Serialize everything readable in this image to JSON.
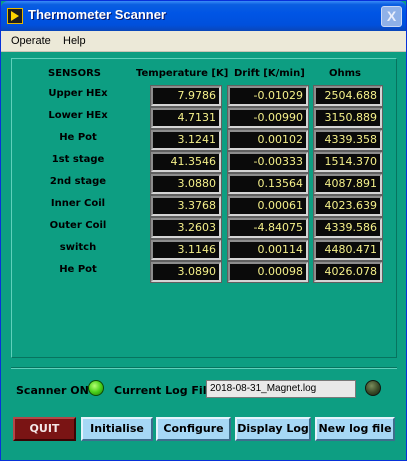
{
  "window": {
    "title": "Thermometer Scanner",
    "close_glyph": "X"
  },
  "menu": [
    "Operate",
    "Help"
  ],
  "table": {
    "headers": {
      "sensors": "SENSORS",
      "temperature": "Temperature [K]",
      "drift": "Drift [K/min]",
      "ohms": "Ohms"
    },
    "rows": [
      {
        "sensor": "Upper HEx",
        "temperature": "7.9786",
        "drift": "-0.01029",
        "ohms": "2504.688"
      },
      {
        "sensor": "Lower HEx",
        "temperature": "4.7131",
        "drift": "-0.00990",
        "ohms": "3150.889"
      },
      {
        "sensor": "He Pot",
        "temperature": "3.1241",
        "drift": "0.00102",
        "ohms": "4339.358"
      },
      {
        "sensor": "1st stage",
        "temperature": "41.3546",
        "drift": "-0.00333",
        "ohms": "1514.370"
      },
      {
        "sensor": "2nd stage",
        "temperature": "3.0880",
        "drift": "0.13564",
        "ohms": "4087.891"
      },
      {
        "sensor": "Inner Coil",
        "temperature": "3.3768",
        "drift": "0.00061",
        "ohms": "4023.639"
      },
      {
        "sensor": "Outer Coil",
        "temperature": "3.2603",
        "drift": "-4.84075",
        "ohms": "4339.586"
      },
      {
        "sensor": "switch",
        "temperature": "3.1146",
        "drift": "0.00114",
        "ohms": "4480.471"
      },
      {
        "sensor": "He Pot",
        "temperature": "3.0890",
        "drift": "0.00098",
        "ohms": "4026.078"
      }
    ]
  },
  "status": {
    "scanner_label": "Scanner ON",
    "scanner_led": "on",
    "log_label": "Current Log File",
    "log_file": "2018-08-31_Magnet.log",
    "log_led": "off"
  },
  "buttons": {
    "quit": "QUIT",
    "initialise": "Initialise",
    "configure": "Configure",
    "display_log": "Display Log",
    "new_log": "New log file"
  }
}
